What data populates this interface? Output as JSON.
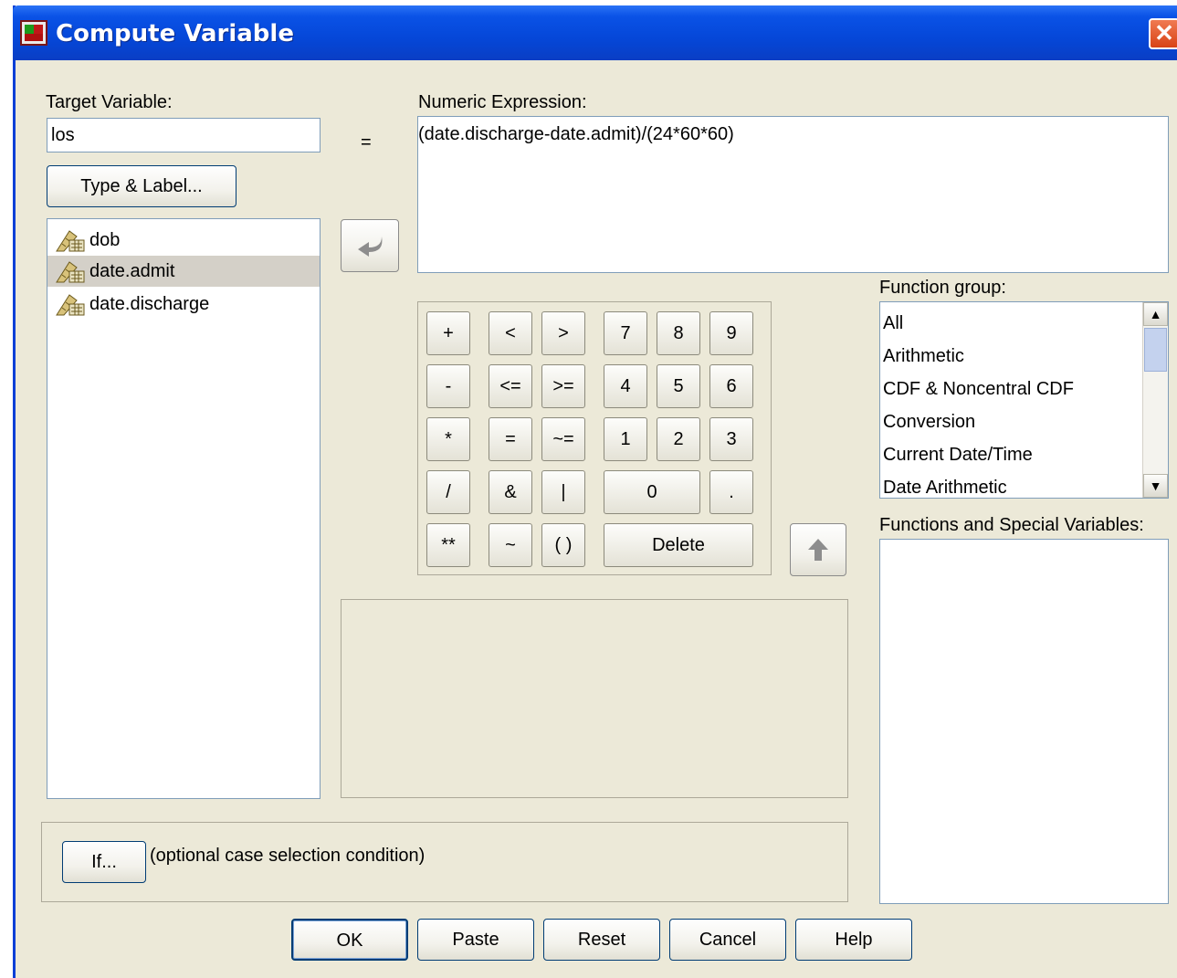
{
  "window": {
    "title": "Compute Variable",
    "close_glyph": "✕"
  },
  "target": {
    "label": "Target Variable:",
    "value": "los",
    "type_label_button": "Type & Label..."
  },
  "equals": "=",
  "expression": {
    "label": "Numeric Expression:",
    "value": "(date.discharge-date.admit)/(24*60*60)"
  },
  "variables": [
    {
      "name": "dob",
      "selected": false
    },
    {
      "name": "date.admit",
      "selected": true
    },
    {
      "name": "date.discharge",
      "selected": false
    }
  ],
  "keypad": {
    "plus": "+",
    "lt": "<",
    "gt": ">",
    "k7": "7",
    "k8": "8",
    "k9": "9",
    "minus": "-",
    "le": "<=",
    "ge": ">=",
    "k4": "4",
    "k5": "5",
    "k6": "6",
    "mult": "*",
    "eq": "=",
    "ne": "~=",
    "k1": "1",
    "k2": "2",
    "k3": "3",
    "div": "/",
    "and": "&",
    "or": "|",
    "k0": "0",
    "dot": ".",
    "pow": "**",
    "not": "~",
    "parens": "( )",
    "delete": "Delete"
  },
  "function_group": {
    "label": "Function group:",
    "items": [
      "All",
      "Arithmetic",
      "CDF & Noncentral CDF",
      "Conversion",
      "Current Date/Time",
      "Date Arithmetic"
    ]
  },
  "functions_label": "Functions and Special Variables:",
  "if_section": {
    "button": "If...",
    "text": "(optional case selection condition)"
  },
  "buttons": {
    "ok": "OK",
    "paste": "Paste",
    "reset": "Reset",
    "cancel": "Cancel",
    "help": "Help"
  },
  "icons": {
    "move_arrow": "curved-left-arrow-icon",
    "up_arrow": "up-arrow-icon",
    "variable": "ruler-scale-icon"
  }
}
